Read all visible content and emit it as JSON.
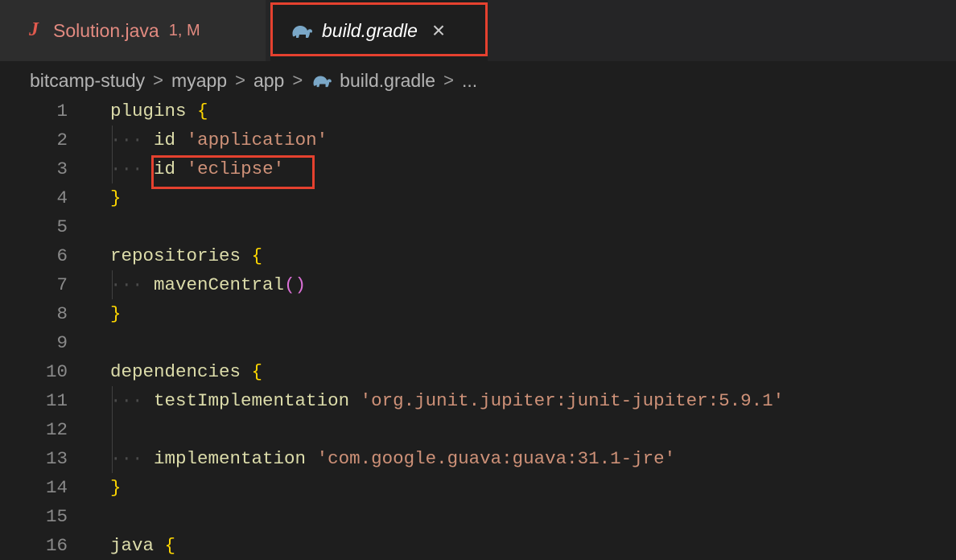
{
  "tabs": [
    {
      "icon": "java-file-icon",
      "label": "Solution.java",
      "status": "1, M"
    },
    {
      "icon": "gradle-elephant-icon",
      "label": "build.gradle",
      "close": "×"
    }
  ],
  "breadcrumb": {
    "items": [
      "bitcamp-study",
      "myapp",
      "app",
      "build.gradle",
      "..."
    ],
    "separator": ">"
  },
  "editor": {
    "lines": [
      {
        "n": "1",
        "tokens": [
          [
            "kw",
            "plugins"
          ],
          [
            "",
            " "
          ],
          [
            "br1",
            "{"
          ]
        ]
      },
      {
        "n": "2",
        "tokens": [
          [
            "dots",
            "···"
          ],
          [
            "",
            " "
          ],
          [
            "kw",
            "id"
          ],
          [
            "",
            " "
          ],
          [
            "str",
            "'application'"
          ]
        ]
      },
      {
        "n": "3",
        "tokens": [
          [
            "dots",
            "···"
          ],
          [
            "",
            " "
          ],
          [
            "kw",
            "id"
          ],
          [
            "",
            " "
          ],
          [
            "str",
            "'eclipse'"
          ]
        ]
      },
      {
        "n": "4",
        "tokens": [
          [
            "br1",
            "}"
          ]
        ]
      },
      {
        "n": "5",
        "tokens": []
      },
      {
        "n": "6",
        "tokens": [
          [
            "kw",
            "repositories"
          ],
          [
            "",
            " "
          ],
          [
            "br1",
            "{"
          ]
        ]
      },
      {
        "n": "7",
        "tokens": [
          [
            "dots",
            "···"
          ],
          [
            "",
            " "
          ],
          [
            "kw",
            "mavenCentral"
          ],
          [
            "br2",
            "()"
          ]
        ]
      },
      {
        "n": "8",
        "tokens": [
          [
            "br1",
            "}"
          ]
        ]
      },
      {
        "n": "9",
        "tokens": []
      },
      {
        "n": "10",
        "tokens": [
          [
            "kw",
            "dependencies"
          ],
          [
            "",
            " "
          ],
          [
            "br1",
            "{"
          ]
        ]
      },
      {
        "n": "11",
        "tokens": [
          [
            "dots",
            "···"
          ],
          [
            "",
            " "
          ],
          [
            "kw",
            "testImplementation"
          ],
          [
            "",
            " "
          ],
          [
            "str",
            "'org.junit.jupiter:junit-jupiter:5.9.1'"
          ]
        ]
      },
      {
        "n": "12",
        "tokens": []
      },
      {
        "n": "13",
        "tokens": [
          [
            "dots",
            "···"
          ],
          [
            "",
            " "
          ],
          [
            "kw",
            "implementation"
          ],
          [
            "",
            " "
          ],
          [
            "str",
            "'com.google.guava:guava:31.1-jre'"
          ]
        ]
      },
      {
        "n": "14",
        "tokens": [
          [
            "br1",
            "}"
          ]
        ]
      },
      {
        "n": "15",
        "tokens": []
      },
      {
        "n": "16",
        "tokens": [
          [
            "kw",
            "java"
          ],
          [
            "",
            " "
          ],
          [
            "br1",
            "{"
          ]
        ]
      }
    ]
  },
  "colors": {
    "highlight": "#e5412f",
    "editor_bg": "#1e1e1e",
    "tab_inactive_bg": "#2d2d2d"
  }
}
